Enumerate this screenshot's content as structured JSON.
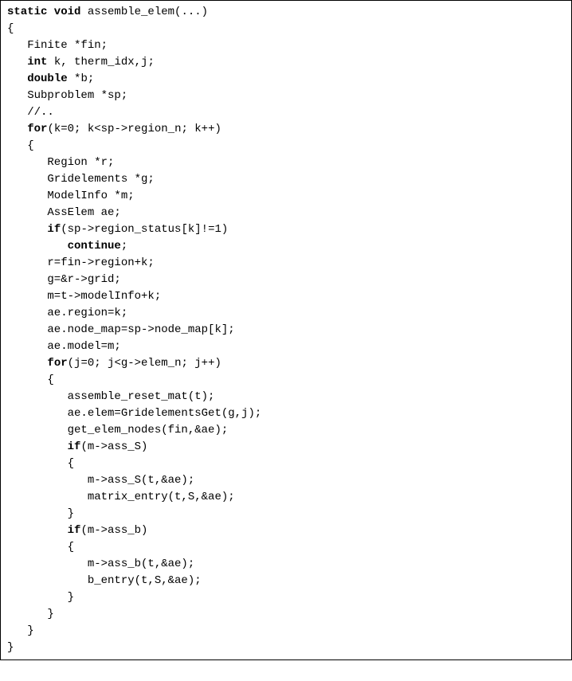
{
  "code": {
    "lines": [
      {
        "indent": 0,
        "spans": [
          {
            "t": "static void",
            "k": true
          },
          {
            "t": " assemble_elem(...)"
          }
        ]
      },
      {
        "indent": 0,
        "spans": [
          {
            "t": "{"
          }
        ]
      },
      {
        "indent": 1,
        "spans": [
          {
            "t": "Finite *fin;"
          }
        ]
      },
      {
        "indent": 1,
        "spans": [
          {
            "t": "int",
            "k": true
          },
          {
            "t": " k, therm_idx,j;"
          }
        ]
      },
      {
        "indent": 1,
        "spans": [
          {
            "t": "double",
            "k": true
          },
          {
            "t": " *b;"
          }
        ]
      },
      {
        "indent": 1,
        "spans": [
          {
            "t": "Subproblem *sp;"
          }
        ]
      },
      {
        "indent": 1,
        "spans": [
          {
            "t": "//.."
          }
        ]
      },
      {
        "indent": 1,
        "spans": [
          {
            "t": "for",
            "k": true
          },
          {
            "t": "(k=0; k<sp->region_n; k++)"
          }
        ]
      },
      {
        "indent": 1,
        "spans": [
          {
            "t": "{"
          }
        ]
      },
      {
        "indent": 2,
        "spans": [
          {
            "t": "Region *r;"
          }
        ]
      },
      {
        "indent": 2,
        "spans": [
          {
            "t": "Gridelements *g;"
          }
        ]
      },
      {
        "indent": 2,
        "spans": [
          {
            "t": "ModelInfo *m;"
          }
        ]
      },
      {
        "indent": 2,
        "spans": [
          {
            "t": "AssElem ae;"
          }
        ]
      },
      {
        "indent": 2,
        "spans": [
          {
            "t": "if",
            "k": true
          },
          {
            "t": "(sp->region_status[k]!=1)"
          }
        ]
      },
      {
        "indent": 3,
        "spans": [
          {
            "t": "continue",
            "k": true
          },
          {
            "t": ";"
          }
        ]
      },
      {
        "indent": 2,
        "spans": [
          {
            "t": "r=fin->region+k;"
          }
        ]
      },
      {
        "indent": 2,
        "spans": [
          {
            "t": "g=&r->grid;"
          }
        ]
      },
      {
        "indent": 2,
        "spans": [
          {
            "t": "m=t->modelInfo+k;"
          }
        ]
      },
      {
        "indent": 2,
        "spans": [
          {
            "t": "ae.region=k;"
          }
        ]
      },
      {
        "indent": 2,
        "spans": [
          {
            "t": "ae.node_map=sp->node_map[k];"
          }
        ]
      },
      {
        "indent": 2,
        "spans": [
          {
            "t": "ae.model=m;"
          }
        ]
      },
      {
        "indent": 2,
        "spans": [
          {
            "t": "for",
            "k": true
          },
          {
            "t": "(j=0; j<g->elem_n; j++)"
          }
        ]
      },
      {
        "indent": 2,
        "spans": [
          {
            "t": "{"
          }
        ]
      },
      {
        "indent": 3,
        "spans": [
          {
            "t": "assemble_reset_mat(t);"
          }
        ]
      },
      {
        "indent": 3,
        "spans": [
          {
            "t": "ae.elem=GridelementsGet(g,j);"
          }
        ]
      },
      {
        "indent": 3,
        "spans": [
          {
            "t": "get_elem_nodes(fin,&ae);"
          }
        ]
      },
      {
        "indent": 3,
        "spans": [
          {
            "t": "if",
            "k": true
          },
          {
            "t": "(m->ass_S)"
          }
        ]
      },
      {
        "indent": 3,
        "spans": [
          {
            "t": "{"
          }
        ]
      },
      {
        "indent": 4,
        "spans": [
          {
            "t": "m->ass_S(t,&ae);"
          }
        ]
      },
      {
        "indent": 4,
        "spans": [
          {
            "t": "matrix_entry(t,S,&ae);"
          }
        ]
      },
      {
        "indent": 3,
        "spans": [
          {
            "t": "}"
          }
        ]
      },
      {
        "indent": 3,
        "spans": [
          {
            "t": "if",
            "k": true
          },
          {
            "t": "(m->ass_b)"
          }
        ]
      },
      {
        "indent": 3,
        "spans": [
          {
            "t": "{"
          }
        ]
      },
      {
        "indent": 4,
        "spans": [
          {
            "t": "m->ass_b(t,&ae);"
          }
        ]
      },
      {
        "indent": 4,
        "spans": [
          {
            "t": "b_entry(t,S,&ae);"
          }
        ]
      },
      {
        "indent": 3,
        "spans": [
          {
            "t": "}"
          }
        ]
      },
      {
        "indent": 2,
        "spans": [
          {
            "t": "}"
          }
        ]
      },
      {
        "indent": 1,
        "spans": [
          {
            "t": "}"
          }
        ]
      },
      {
        "indent": 0,
        "spans": [
          {
            "t": "}"
          }
        ]
      }
    ]
  }
}
